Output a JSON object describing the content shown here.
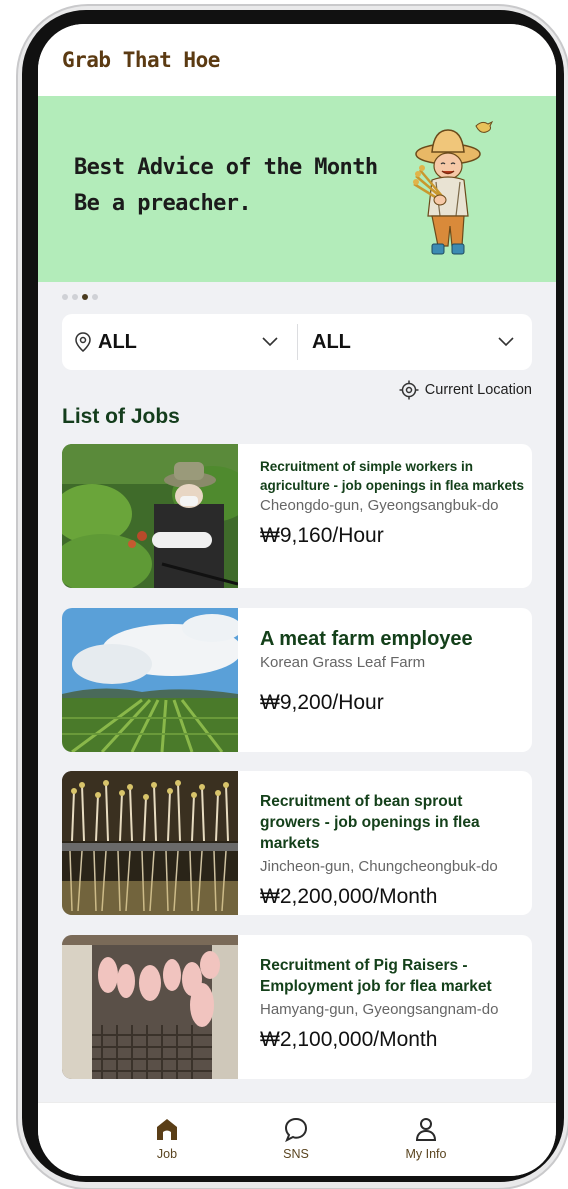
{
  "app": {
    "title": "Grab That Hoe"
  },
  "banner": {
    "line1": "Best Advice of the Month",
    "line2": "Be a preacher.",
    "page_indicator": {
      "count": 4,
      "active_index": 2
    }
  },
  "filters": {
    "region": {
      "icon": "location-pin-icon",
      "value": "ALL"
    },
    "category": {
      "value": "ALL"
    },
    "current_location_label": "Current Location"
  },
  "section": {
    "title": "List of Jobs"
  },
  "jobs": [
    {
      "title": "Recruitment of simple workers in agriculture - job openings in flea markets",
      "location": "Cheongdo-gun, Gyeongsangbuk-do",
      "pay": "₩9,160/Hour"
    },
    {
      "title": "A meat farm employee",
      "location": "Korean Grass Leaf Farm",
      "pay": "₩9,200/Hour"
    },
    {
      "title": "Recruitment of bean sprout growers - job openings in flea markets",
      "location": "Jincheon-gun, Chungcheongbuk-do",
      "pay": "₩2,200,000/Month"
    },
    {
      "title": "Recruitment of Pig Raisers - Employment job for flea market",
      "location": "Hamyang-gun, Gyeongsangnam-do",
      "pay": "₩2,100,000/Month"
    }
  ],
  "nav": {
    "items": [
      {
        "label": "Job",
        "icon": "home-icon",
        "active": true
      },
      {
        "label": "SNS",
        "icon": "chat-bubble-icon",
        "active": false
      },
      {
        "label": "My Info",
        "icon": "user-icon",
        "active": false
      }
    ]
  },
  "colors": {
    "brand_brown": "#5b3a12",
    "banner_green": "#b3ecba",
    "title_green": "#14401a",
    "background": "#f0f1f4"
  }
}
